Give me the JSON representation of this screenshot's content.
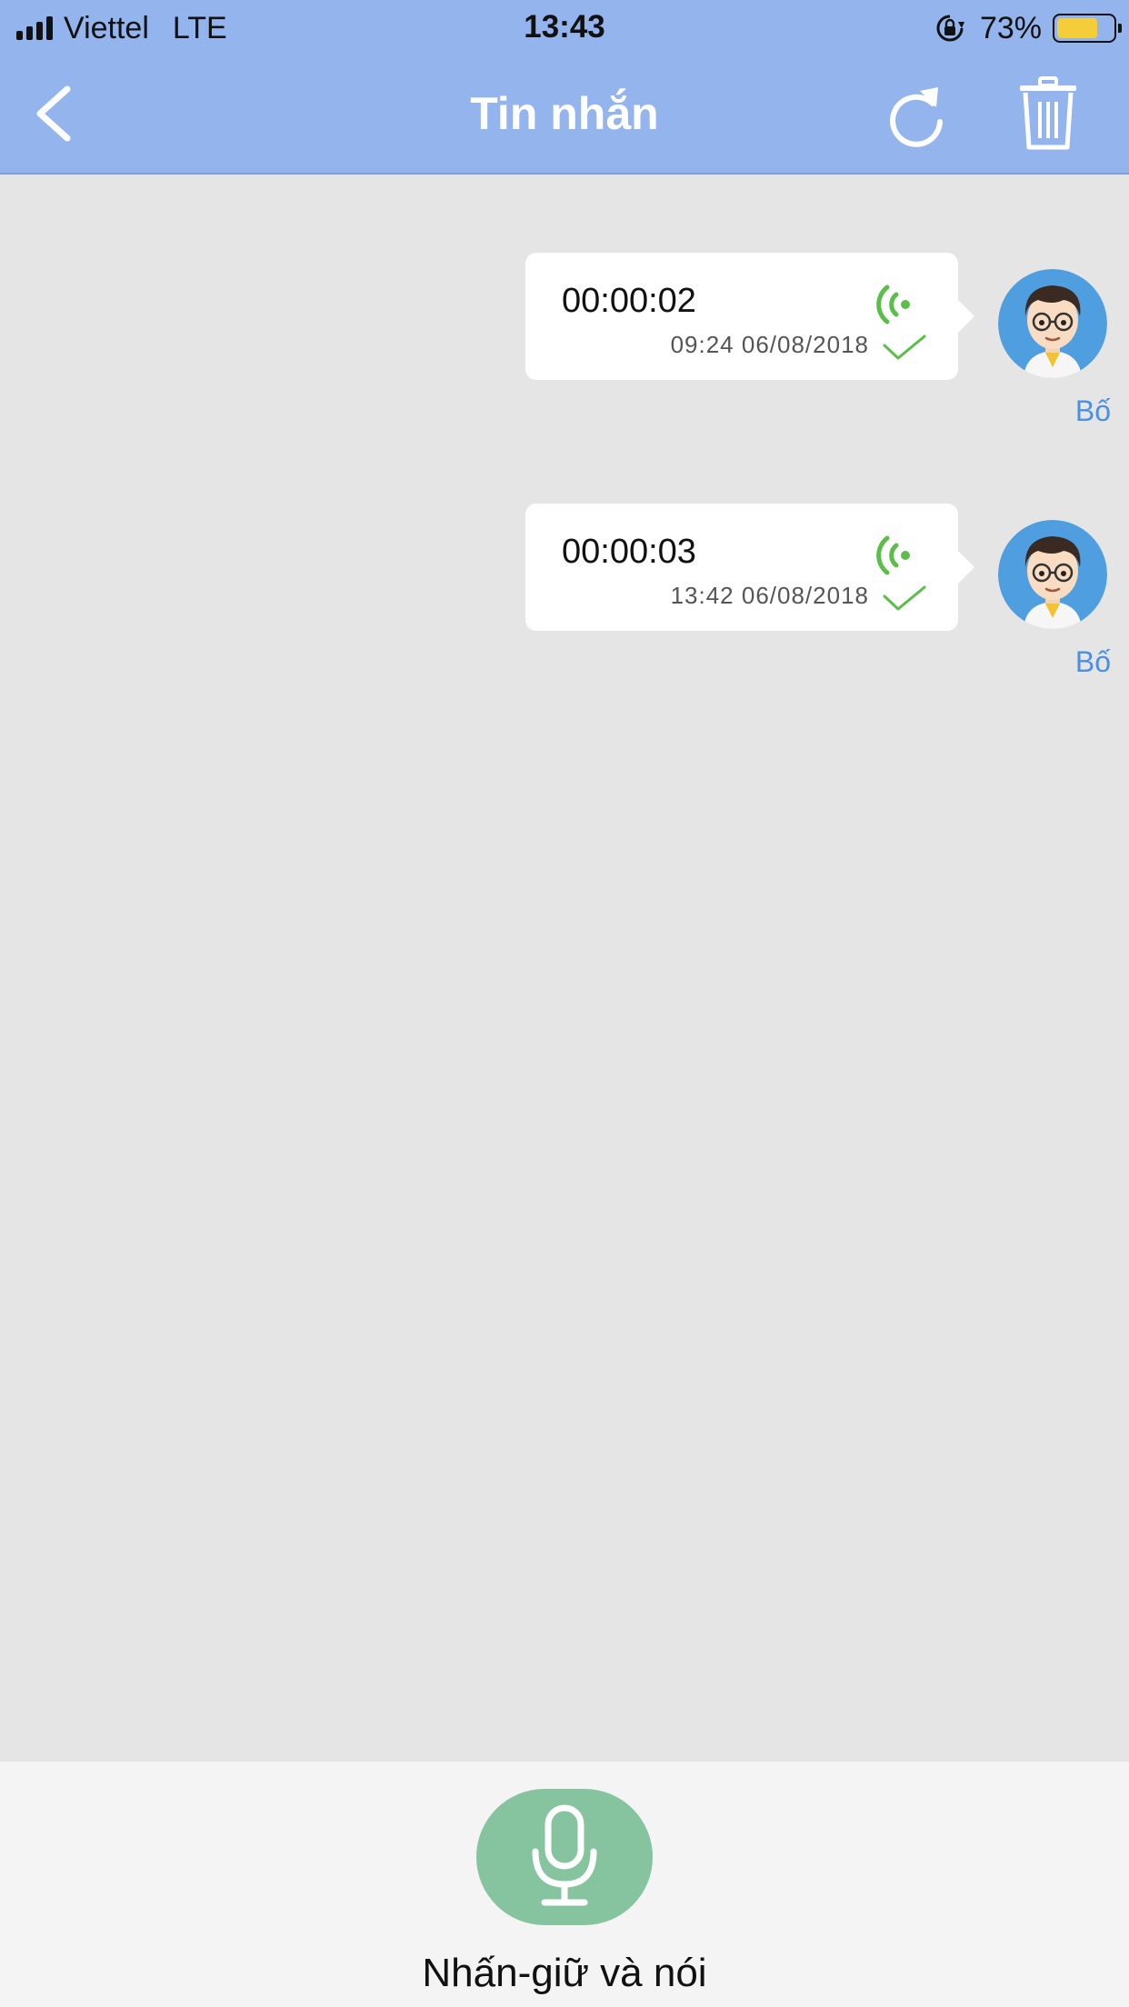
{
  "status_bar": {
    "carrier": "Viettel",
    "network": "LTE",
    "time": "13:43",
    "battery_percent_label": "73%",
    "battery_level": 0.73,
    "icons": [
      "signal-icon",
      "rotation-lock-icon",
      "battery-icon"
    ]
  },
  "nav": {
    "title": "Tin nhắn",
    "icons": [
      "back-icon",
      "refresh-icon",
      "trash-icon"
    ]
  },
  "messages": [
    {
      "duration": "00:00:02",
      "timestamp": "09:24 06/08/2018",
      "sender": "Bố"
    },
    {
      "duration": "00:00:03",
      "timestamp": "13:42 06/08/2018",
      "sender": "Bố"
    }
  ],
  "bottom": {
    "record_label": "Nhấn-giữ và nói",
    "icon": "microphone-icon"
  },
  "colors": {
    "header": "#93b4ed",
    "chat_background": "#e5e5e5",
    "bubble": "#ffffff",
    "wave_green": "#5cbe4a",
    "sender_blue": "#4a90e2",
    "mic_button": "#85c49e",
    "bottom_bar": "#f4f4f4"
  }
}
